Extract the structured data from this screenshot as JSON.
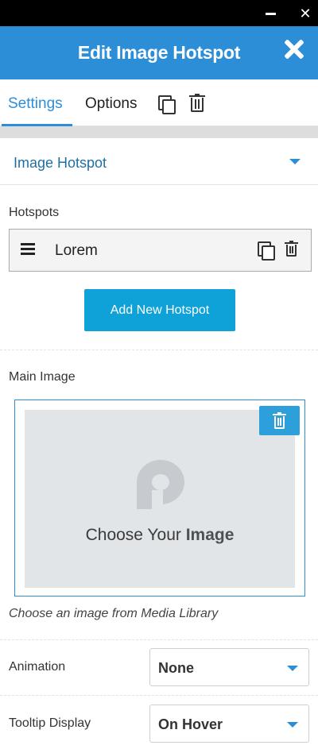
{
  "window": {
    "minimize_glyph": "",
    "close_glyph": "✕"
  },
  "header": {
    "title": "Edit Image Hotspot"
  },
  "tabs": [
    {
      "label": "Settings",
      "active": true
    },
    {
      "label": "Options",
      "active": false
    }
  ],
  "colors": {
    "accent": "#2d8ed8",
    "button": "#0ea2d8",
    "section_title": "#1f6fa3"
  },
  "section": {
    "title": "Image Hotspot"
  },
  "hotspots": {
    "label": "Hotspots",
    "items": [
      {
        "name": "Lorem"
      }
    ],
    "add_button": "Add New Hotspot"
  },
  "main_image": {
    "label": "Main Image",
    "choose_prefix": "Choose  Your ",
    "choose_bold": "Image",
    "caption": "Choose an image from Media Library"
  },
  "animation": {
    "label": "Animation",
    "value": "None"
  },
  "tooltip_display": {
    "label": "Tooltip Display",
    "value": "On Hover"
  }
}
